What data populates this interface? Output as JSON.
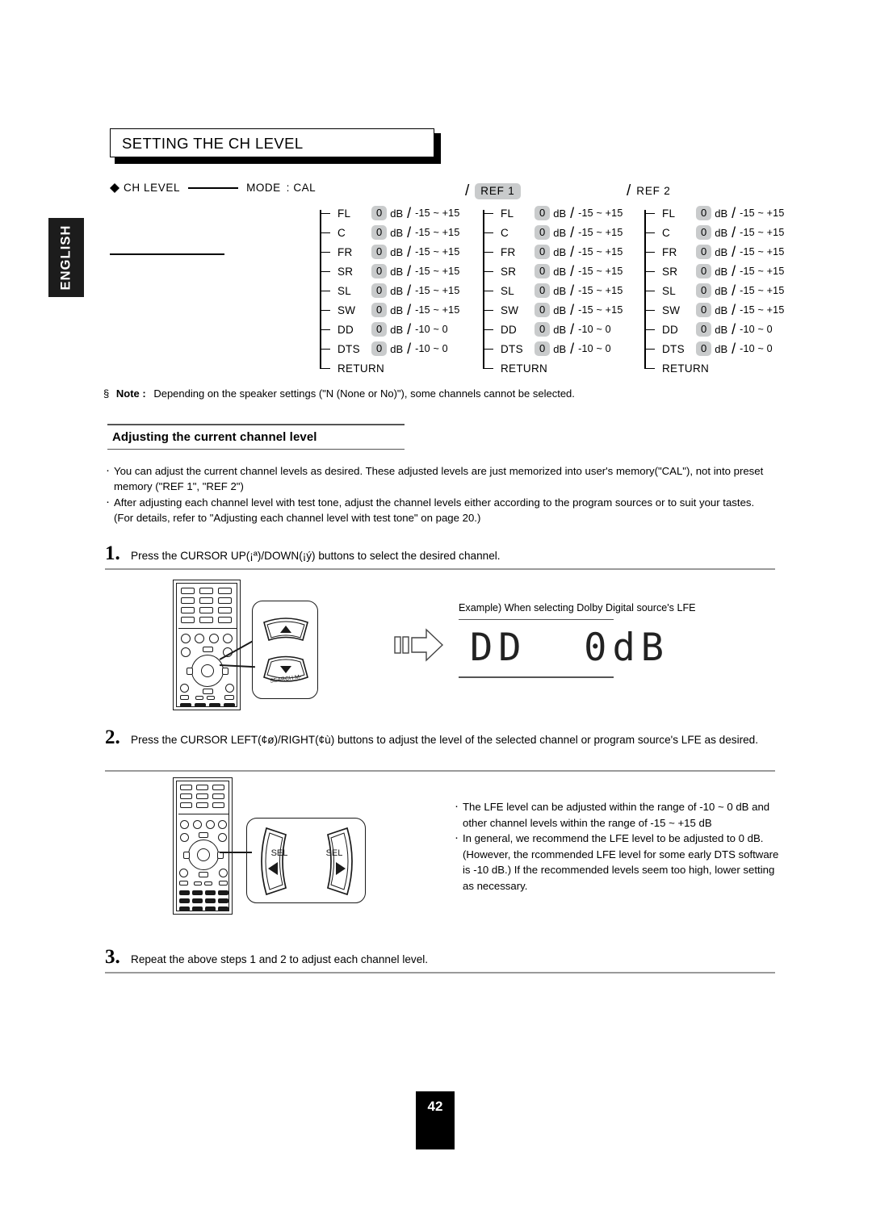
{
  "language_tab": "ENGLISH",
  "header": {
    "title": "SETTING THE CH LEVEL"
  },
  "ch_level_row": {
    "bullet_label": "CH LEVEL",
    "mode_label": "MODE",
    "mode_separator": ":",
    "mode_value": "CAL"
  },
  "tree": {
    "columns": [
      {
        "name": "cal",
        "slash": "/",
        "header": "MODE : CAL",
        "header_highlight": false,
        "show_header": false,
        "rows": [
          {
            "channel": "FL",
            "value": "0",
            "unit": "dB",
            "slash": "/",
            "range": "-15 ~ +15"
          },
          {
            "channel": "C",
            "value": "0",
            "unit": "dB",
            "slash": "/",
            "range": "-15 ~ +15"
          },
          {
            "channel": "FR",
            "value": "0",
            "unit": "dB",
            "slash": "/",
            "range": "-15 ~ +15"
          },
          {
            "channel": "SR",
            "value": "0",
            "unit": "dB",
            "slash": "/",
            "range": "-15 ~ +15"
          },
          {
            "channel": "SL",
            "value": "0",
            "unit": "dB",
            "slash": "/",
            "range": "-15 ~ +15"
          },
          {
            "channel": "SW",
            "value": "0",
            "unit": "dB",
            "slash": "/",
            "range": "-15 ~ +15"
          },
          {
            "channel": "DD",
            "value": "0",
            "unit": "dB",
            "slash": "/",
            "range": "-10 ~ 0"
          },
          {
            "channel": "DTS",
            "value": "0",
            "unit": "dB",
            "slash": "/",
            "range": "-10 ~ 0"
          }
        ],
        "return_label": "RETURN"
      },
      {
        "name": "ref1",
        "slash": "/",
        "header": "REF 1",
        "header_highlight": true,
        "show_header": true,
        "rows": [
          {
            "channel": "FL",
            "value": "0",
            "unit": "dB",
            "slash": "/",
            "range": "-15 ~ +15"
          },
          {
            "channel": "C",
            "value": "0",
            "unit": "dB",
            "slash": "/",
            "range": "-15 ~ +15"
          },
          {
            "channel": "FR",
            "value": "0",
            "unit": "dB",
            "slash": "/",
            "range": "-15 ~ +15"
          },
          {
            "channel": "SR",
            "value": "0",
            "unit": "dB",
            "slash": "/",
            "range": "-15 ~ +15"
          },
          {
            "channel": "SL",
            "value": "0",
            "unit": "dB",
            "slash": "/",
            "range": "-15 ~ +15"
          },
          {
            "channel": "SW",
            "value": "0",
            "unit": "dB",
            "slash": "/",
            "range": "-15 ~ +15"
          },
          {
            "channel": "DD",
            "value": "0",
            "unit": "dB",
            "slash": "/",
            "range": "-10 ~ 0"
          },
          {
            "channel": "DTS",
            "value": "0",
            "unit": "dB",
            "slash": "/",
            "range": "-10 ~ 0"
          }
        ],
        "return_label": "RETURN"
      },
      {
        "name": "ref2",
        "slash": "/",
        "header": "REF  2",
        "header_highlight": false,
        "show_header": true,
        "rows": [
          {
            "channel": "FL",
            "value": "0",
            "unit": "dB",
            "slash": "/",
            "range": "-15 ~ +15"
          },
          {
            "channel": "C",
            "value": "0",
            "unit": "dB",
            "slash": "/",
            "range": "-15 ~ +15"
          },
          {
            "channel": "FR",
            "value": "0",
            "unit": "dB",
            "slash": "/",
            "range": "-15 ~ +15"
          },
          {
            "channel": "SR",
            "value": "0",
            "unit": "dB",
            "slash": "/",
            "range": "-15 ~ +15"
          },
          {
            "channel": "SL",
            "value": "0",
            "unit": "dB",
            "slash": "/",
            "range": "-15 ~ +15"
          },
          {
            "channel": "SW",
            "value": "0",
            "unit": "dB",
            "slash": "/",
            "range": "-15 ~ +15"
          },
          {
            "channel": "DD",
            "value": "0",
            "unit": "dB",
            "slash": "/",
            "range": "-10 ~ 0"
          },
          {
            "channel": "DTS",
            "value": "0",
            "unit": "dB",
            "slash": "/",
            "range": "-10 ~ 0"
          }
        ],
        "return_label": "RETURN"
      }
    ]
  },
  "note": {
    "symbol": "§",
    "label": "Note :",
    "text": "Depending on the speaker settings (\"N (None or No)\"), some channels cannot be selected."
  },
  "subsection": {
    "title": "Adjusting the current channel level"
  },
  "intro_bullets": [
    "You can adjust the current channel levels as desired. These adjusted levels are just memorized into user's memory(\"CAL\"), not into preset memory (\"REF 1\", \"REF 2\")",
    "After adjusting each channel level with test tone, adjust the channel levels either according to the program sources or to suit your tastes. (For details, refer to \"Adjusting each channel level with test tone\" on page 20.)"
  ],
  "steps": [
    {
      "number": "1.",
      "text": "Press the CURSOR UP(¡ª)/DOWN(¡ý) buttons to select the desired channel."
    },
    {
      "number": "2.",
      "text": "Press the CURSOR LEFT(¢ø)/RIGHT(¢ù) buttons to adjust the level of the selected channel or  program source's LFE as desired."
    },
    {
      "number": "3.",
      "text": "Repeat the above steps 1 and 2 to adjust each channel level."
    }
  ],
  "step1_callout": {
    "up_key_label": "",
    "down_key_label": "SEARCH M-"
  },
  "lcd_example": {
    "caption": "Example) When selecting Dolby Digital source's LFE",
    "display": "DD  0dB"
  },
  "step2_callout": {
    "left_key_label": "SEL",
    "right_key_label": "SEL"
  },
  "step2_bullets": [
    "The LFE level can be adjusted within the range of -10 ~ 0 dB and other channel levels within the range of -15 ~ +15 dB",
    "In general, we recommend the LFE level to be adjusted to 0 dB. (However, the rcommended LFE level for some early DTS software is -10 dB.)  If the recommended levels seem too high, lower setting as necessary."
  ],
  "footer": {
    "page_number": "42"
  },
  "colors": {
    "badge_grey": "#c9cbcc",
    "rule_grey": "#9a9a9a",
    "ink": "#1a1a1a"
  }
}
